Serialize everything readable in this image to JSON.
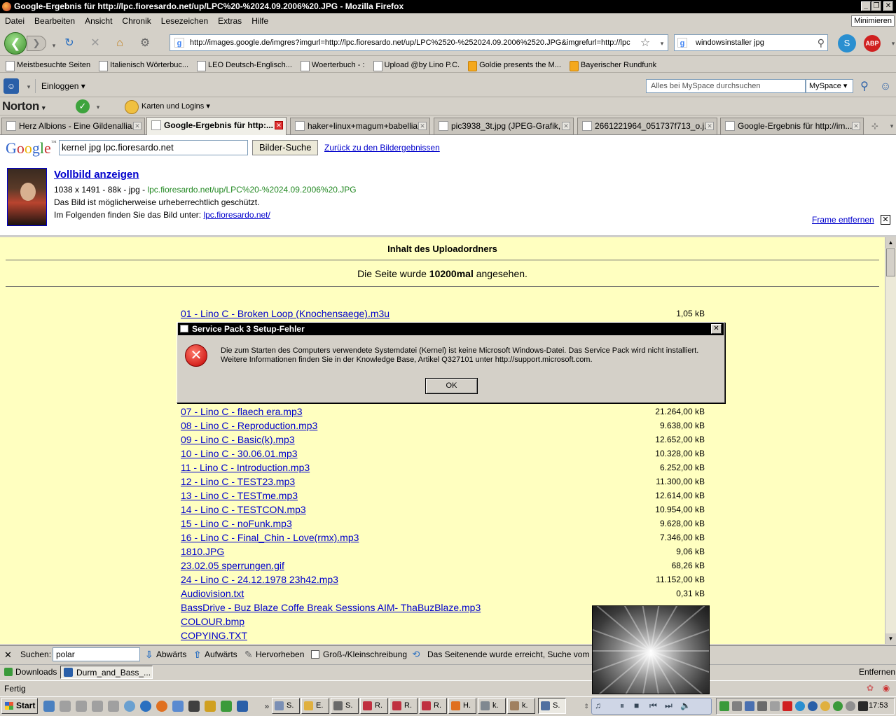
{
  "window": {
    "title": "Google-Ergebnis für http://lpc.fioresardo.net/up/LPC%20-%2024.09.2006%20.JPG - Mozilla Firefox",
    "minimize_label": "Minimieren"
  },
  "menu": [
    "Datei",
    "Bearbeiten",
    "Ansicht",
    "Chronik",
    "Lesezeichen",
    "Extras",
    "Hilfe"
  ],
  "nav": {
    "url": "http://images.google.de/imgres?imgurl=http://lpc.fioresardo.net/up/LPC%2520-%252024.09.2006%2520.JPG&imgrefurl=http://lpc",
    "search_value": "windowsinstaller jpg"
  },
  "bookmarks": [
    {
      "label": "Meistbesuchte Seiten",
      "type": "page"
    },
    {
      "label": "Italienisch Wörterbuc...",
      "type": "page"
    },
    {
      "label": "LEO Deutsch-Englisch...",
      "type": "page"
    },
    {
      "label": "Woerterbuch - :",
      "type": "page"
    },
    {
      "label": "Upload @by Lino P.C.",
      "type": "page"
    },
    {
      "label": "Goldie presents the M...",
      "type": "feed"
    },
    {
      "label": "Bayerischer Rundfunk",
      "type": "feed"
    }
  ],
  "myspace": {
    "login_label": "Einloggen",
    "search_placeholder": "Alles bei MySpace durchsuchen",
    "search_scope": "MySpace"
  },
  "norton": {
    "logo": "Norton",
    "karten_label": "Karten und Logins"
  },
  "tabs": [
    {
      "label": "Herz Albions - Eine Gildenallia...",
      "active": false
    },
    {
      "label": "Google-Ergebnis für http:...",
      "active": true
    },
    {
      "label": "haker+linux+magum+babellia...",
      "active": false
    },
    {
      "label": "pic3938_3t.jpg (JPEG-Grafik, ...",
      "active": false
    },
    {
      "label": "2661221964_051737f713_o.j...",
      "active": false
    },
    {
      "label": "Google-Ergebnis für http://im...",
      "active": false
    }
  ],
  "google": {
    "logo_letters": [
      "G",
      "o",
      "o",
      "g",
      "l",
      "e"
    ],
    "logo_tm": "™",
    "query": "kernel jpg lpc.fioresardo.net",
    "search_button": "Bilder-Suche",
    "back_link": "Zurück zu den Bildergebnissen",
    "fullsize_link": "Vollbild anzeigen",
    "image_info": "1038 x 1491 - 88k - jpg - ",
    "image_url": "lpc.fioresardo.net/up/LPC%20-%2024.09.2006%20.JPG",
    "copyright_note": "Das Bild ist möglicherweise urheberrechtlich geschützt.",
    "source_prefix": "Im Folgenden finden Sie das Bild unter: ",
    "source_link": "lpc.fioresardo.net/",
    "remove_frame": "Frame entfernen"
  },
  "page": {
    "heading": "Inhalt des Uploadordners",
    "views_prefix": "Die Seite wurde ",
    "views_count": "10200mal",
    "views_suffix": " angesehen.",
    "files": [
      {
        "name": "01 - Lino C - Broken Loop (Knochensaege).m3u",
        "size": "1,05 kB"
      },
      {
        "name": "07 - Lino C - flaech era.mp3",
        "size": "21.264,00 kB"
      },
      {
        "name": "08 - Lino C - Reproduction.mp3",
        "size": "9.638,00 kB"
      },
      {
        "name": "09 - Lino C - Basic(k).mp3",
        "size": "12.652,00 kB"
      },
      {
        "name": "10 - Lino C - 30.06.01.mp3",
        "size": "10.328,00 kB"
      },
      {
        "name": "11 - Lino C - Introduction.mp3",
        "size": "6.252,00 kB"
      },
      {
        "name": "12 - Lino C - TEST23.mp3",
        "size": "11.300,00 kB"
      },
      {
        "name": "13 - Lino C - TESTme.mp3",
        "size": "12.614,00 kB"
      },
      {
        "name": "14 - Lino C - TESTCON.mp3",
        "size": "10.954,00 kB"
      },
      {
        "name": "15 - Lino C - noFunk.mp3",
        "size": "9.628,00 kB"
      },
      {
        "name": "16 - Lino C - Final_Chin - Love(rmx).mp3",
        "size": "7.346,00 kB"
      },
      {
        "name": "1810.JPG",
        "size": "9,06 kB"
      },
      {
        "name": "23.02.05 sperrungen.gif",
        "size": "68,26 kB"
      },
      {
        "name": "24 - Lino C - 24.12.1978 23h42.mp3",
        "size": "11.152,00 kB"
      },
      {
        "name": "Audiovision.txt",
        "size": "0,31 kB"
      },
      {
        "name": "BassDrive - Buz Blaze Coffe Break Sessions AIM- ThaBuzBlaze.mp3",
        "size": ""
      },
      {
        "name": "COLOUR.bmp",
        "size": ""
      },
      {
        "name": "COPYING.TXT",
        "size": ""
      }
    ]
  },
  "dialog": {
    "title": "Service Pack 3 Setup-Fehler",
    "message": "Die zum Starten des Computers verwendete Systemdatei (Kernel) ist keine Microsoft Windows-Datei. Das Service Pack wird nicht installiert. Weitere Informationen finden Sie in der Knowledge Base, Artikel Q327101 unter http://support.microsoft.com.",
    "ok_label": "OK"
  },
  "findbar": {
    "label": "Suchen:",
    "value": "polar",
    "down": "Abwärts",
    "up": "Aufwärts",
    "highlight": "Hervorheben",
    "case": "Groß-/Kleinschreibung",
    "message": "Das Seitenende wurde erreicht, Suche vom Seite"
  },
  "downloads": {
    "label": "Downloads",
    "item": "Durm_and_Bass_...",
    "remove": "Entfernen"
  },
  "status": "Fertig",
  "taskbar": {
    "start": "Start",
    "buttons": [
      {
        "label": "S.",
        "color": "#7a8fb5"
      },
      {
        "label": "E.",
        "color": "#e0b040"
      },
      {
        "label": "S.",
        "color": "#6a6a6a"
      },
      {
        "label": "R.",
        "color": "#c03040"
      },
      {
        "label": "R.",
        "color": "#c03040"
      },
      {
        "label": "R.",
        "color": "#c03040"
      },
      {
        "label": "H.",
        "color": "#e07020"
      },
      {
        "label": "k.",
        "color": "#808890"
      },
      {
        "label": "k.",
        "color": "#a08060"
      },
      {
        "label": "S.",
        "color": "#5070a0"
      }
    ],
    "clock": "17:53"
  },
  "colors": {
    "content_bg": "#ffffc0",
    "link": "#0000cc",
    "titlebar": "#000000",
    "chrome": "#d4d0c8"
  }
}
